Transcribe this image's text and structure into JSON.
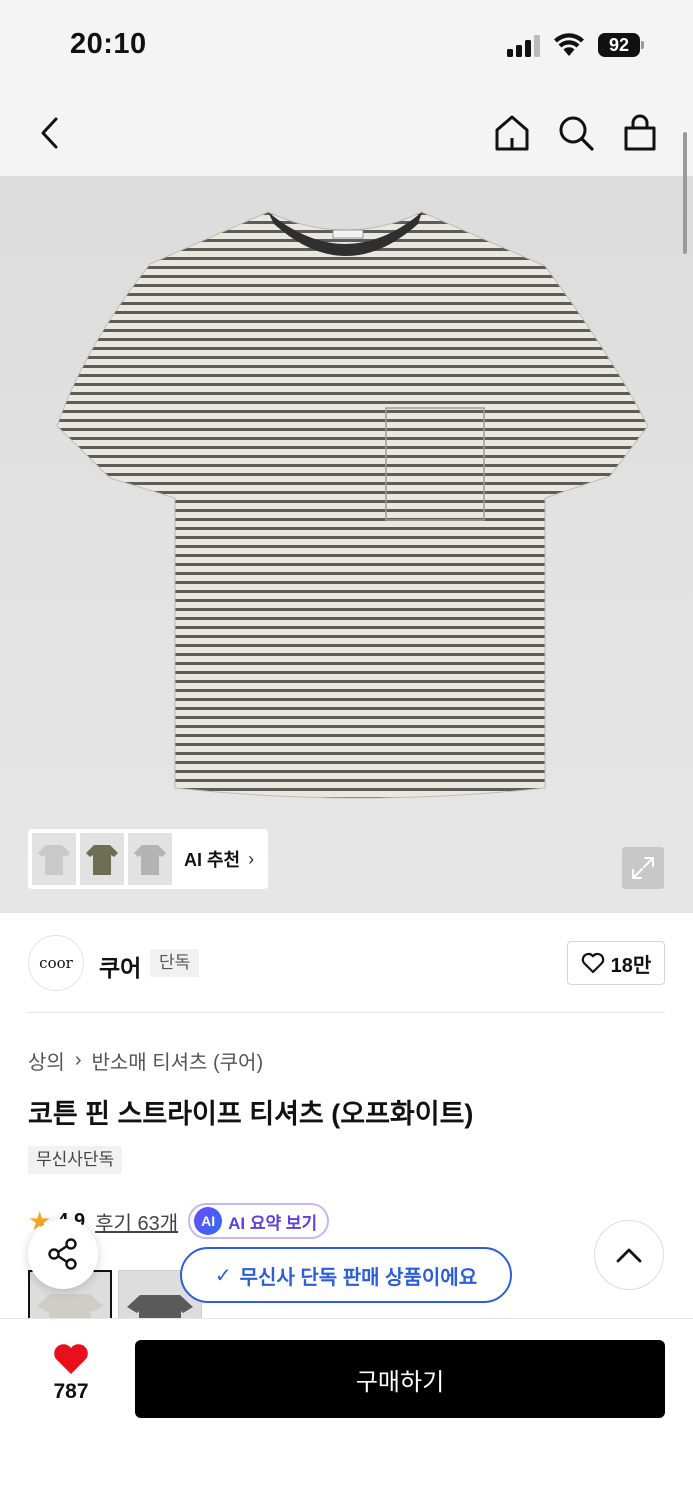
{
  "status_bar": {
    "time": "20:10",
    "battery": "92"
  },
  "nav": {
    "back": "chevron-left-icon",
    "home": "home-icon",
    "search": "search-icon",
    "cart": "shopping-bag-icon"
  },
  "hero": {
    "ai_label": "AI 추천",
    "ai_chevron": "›"
  },
  "brand": {
    "logo_text": "coor",
    "name": "쿠어",
    "tag": "단독",
    "likes": "18만"
  },
  "breadcrumb": {
    "category": "상의",
    "sep": "›",
    "subcategory": "반소매 티셔츠 (쿠어)"
  },
  "product": {
    "title": "코튼 핀 스트라이프 티셔츠 (오프화이트)",
    "badge": "무신사단독"
  },
  "rating": {
    "star": "★",
    "value": "4.9",
    "reviews": "후기 63개",
    "ai_icon": "AI",
    "ai_summary": "AI 요약 보기"
  },
  "toast": {
    "check": "✓",
    "text": "무신사 단독 판매 상품이에요"
  },
  "bottom": {
    "wish_count": "787",
    "buy_label": "구매하기"
  },
  "colors": {
    "heart": "#e8101c",
    "toast": "#2b5fd9",
    "ai_purple": "#5b3fe0",
    "star": "#f5a623"
  }
}
